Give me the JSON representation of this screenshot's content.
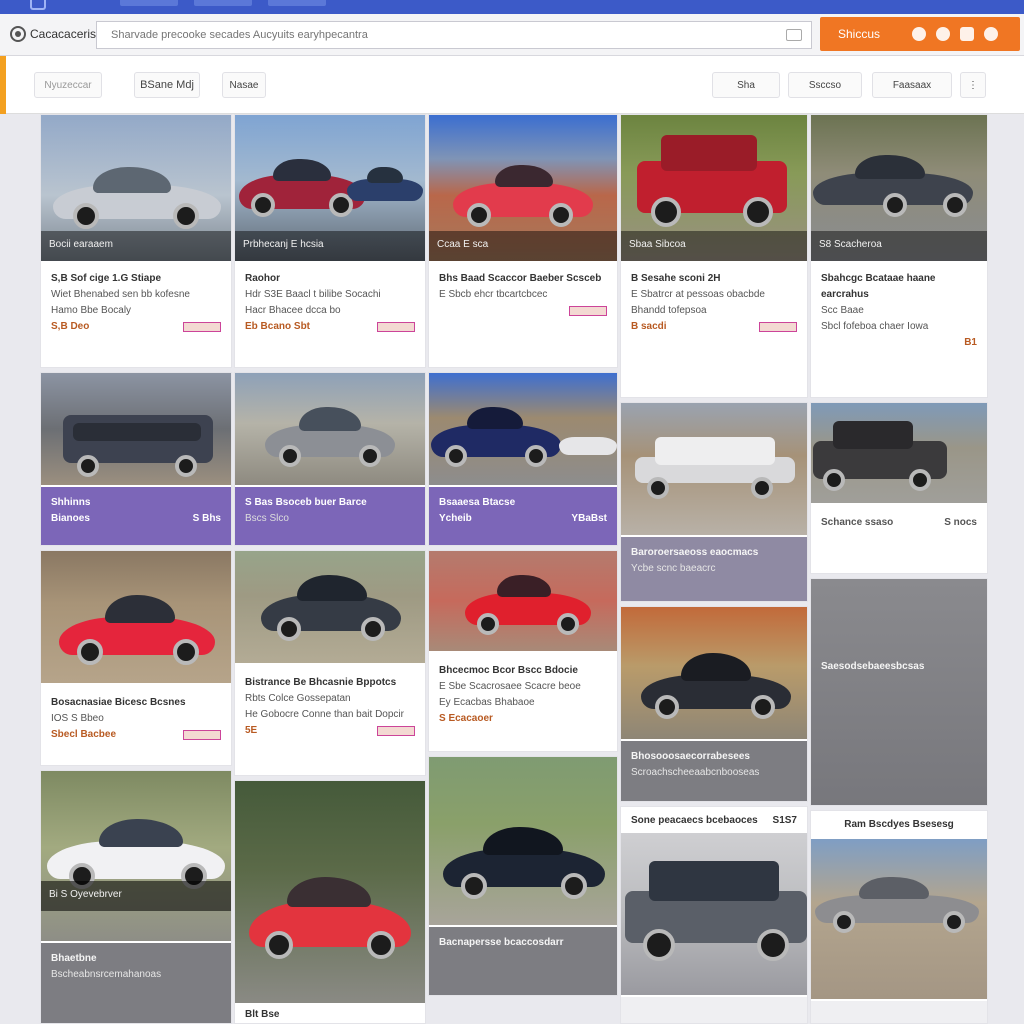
{
  "brand": {
    "name": "Cacacaceris"
  },
  "search": {
    "placeholder": "Sharvade precooke secades Aucyuits earyhpecantra"
  },
  "cta": {
    "label": "Shiccus"
  },
  "filters": [
    {
      "label": "Nyuzeccar"
    },
    {
      "label": "BSane Mdj"
    },
    {
      "label": "Nasae"
    },
    {
      "label": "Sha"
    },
    {
      "label": "Ssccso"
    },
    {
      "label": "Faasaax"
    }
  ],
  "cards": [
    {
      "caption": "Bocii earaaem",
      "title": "S,B Sof cige 1.G Stiape",
      "sub": "Wiet Bhenabed sen bb kofesne",
      "sub2": "Hamo Bbe Bocaly",
      "price": "S,B Deo"
    },
    {
      "caption": "Prbhecanj E hcsia",
      "title": "Raohor",
      "sub": "Hdr S3E Baacl t bilibe Socachi",
      "sub2": "Hacr Bhacee dcca bo",
      "price": "Eb Bcano Sbt"
    },
    {
      "caption": "Ccaa E sca",
      "title": "Bhs Baad Scaccor Baeber Scsceb",
      "sub": "E Sbcb ehcr tbcartcbcec",
      "sub2": "",
      "price": ""
    },
    {
      "caption": "Sbaa Sibcoa",
      "title": "B Sesahe sconi 2H",
      "sub": "E Sbatrcr at pessoas obacbde",
      "sub2": "Bhandd tofepsoa",
      "price": "B sacdi"
    },
    {
      "caption": "S8 Scacheroa",
      "title": "Sbahcgc Bcataae haane earcrahus",
      "sub": "Scc Baae",
      "sub2": "Sbcl fofeboa chaer Iowa",
      "price": "B1"
    },
    {
      "caption": "",
      "title": "Shhinns",
      "sub": "Bianoes",
      "sub2": "",
      "price": "S Bhs"
    },
    {
      "caption": "",
      "title": "S Bas Bsoceb buer Barce",
      "sub": "Bscs Slco",
      "sub2": "",
      "price": ""
    },
    {
      "caption": "",
      "title": "Bsaaesa Btacse",
      "sub": "Ycheib",
      "sub2": "",
      "price": "YBaBst"
    },
    {
      "caption": "",
      "title": "Baroroersaeoss eaocmacs",
      "sub": "Ycbe scnc baeacrc",
      "sub2": "",
      "price": ""
    },
    {
      "caption": "",
      "title": "Schance ssaso",
      "sub": "",
      "sub2": "",
      "price": "S nocs"
    },
    {
      "caption": "",
      "title": "Bosacnasiae Bicesc Bcsnes",
      "sub": "IOS S Bbeo",
      "sub2": "",
      "price": "Sbecl Bacbee"
    },
    {
      "caption": "",
      "title": "Bistrance Be Bhcasnie Bppotcs",
      "sub": "Rbts Colce Gossepatan",
      "sub2": "He Gobocre Conne than bait Dopcir",
      "price": "5E"
    },
    {
      "caption": "",
      "title": "Bhcecmoc Bcor Bscc Bdocie",
      "sub": "E Sbe Scacrosaee Scacre beoe",
      "sub2": "Ey Ecacbas Bhabaoe",
      "price": "S Ecacaoer"
    },
    {
      "caption": "",
      "title": "Bhosooosaecorrabesees",
      "sub": "Scroachscheeaabcnbooseas",
      "sub2": "",
      "price": ""
    },
    {
      "caption": "",
      "title": "Saesodsebaeesbcsas",
      "sub": "",
      "sub2": "",
      "price": ""
    },
    {
      "caption": "Bi S Oyevebrver",
      "title": "Bhaetbne",
      "sub": "Bscheabnsrcemahanoas",
      "sub2": "",
      "price": ""
    },
    {
      "caption": "",
      "title": "Blt Bse",
      "sub": "",
      "sub2": "",
      "price": ""
    },
    {
      "caption": "",
      "title": "Bacnapersse bcaccosdarr",
      "sub": "",
      "sub2": "",
      "price": ""
    },
    {
      "caption": "",
      "title": "Sone peacaecs bcebaoces",
      "sub": "",
      "sub2": "",
      "price": "S1S7"
    },
    {
      "caption": "",
      "title": "Ram Bscdyes Bsesesg",
      "sub": "",
      "sub2": "",
      "price": ""
    }
  ],
  "colors": {
    "header": "#3c5ac8",
    "accent": "#f07623",
    "purple": "#7c66b8",
    "grey": "#7d7d82"
  }
}
